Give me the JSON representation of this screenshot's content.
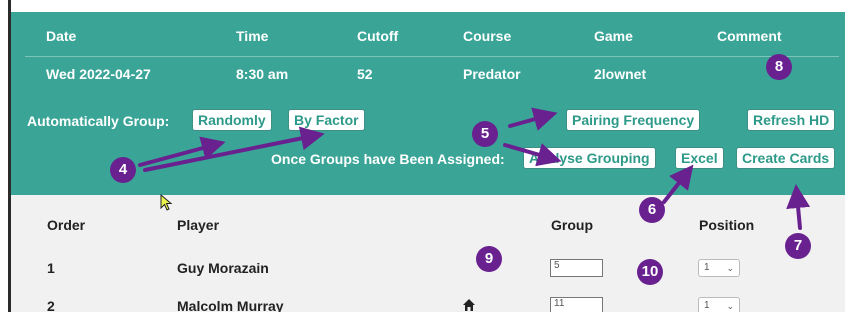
{
  "header": {
    "columns": [
      "Date",
      "Time",
      "Cutoff",
      "Course",
      "Game",
      "Comment"
    ],
    "values": [
      "Wed 2022-04-27",
      "8:30 am",
      "52",
      "Predator",
      "2lownet",
      ""
    ]
  },
  "grouping": {
    "auto_label": "Automatically Group:",
    "randomly": "Randomly",
    "by_factor": "By Factor",
    "pairing_frequency": "Pairing Frequency",
    "refresh_hd": "Refresh HD",
    "assigned_label": "Once Groups have Been Assigned:",
    "analyse_grouping": "Analyse Grouping",
    "excel": "Excel",
    "create_cards": "Create Cards"
  },
  "table": {
    "headers": {
      "order": "Order",
      "player": "Player",
      "group": "Group",
      "position": "Position"
    },
    "rows": [
      {
        "order": "1",
        "player": "Guy Morazain",
        "group": "5",
        "position": "1",
        "home": false
      },
      {
        "order": "2",
        "player": "Malcolm Murray",
        "group": "11",
        "position": "1",
        "home": true
      }
    ]
  },
  "annotations": {
    "color": "#6a2190",
    "badges": [
      "4",
      "5",
      "6",
      "7",
      "8",
      "9",
      "10"
    ]
  },
  "colors": {
    "teal": "#3aa597",
    "button_text": "#2d9a89",
    "grey": "#f1f1f1"
  }
}
